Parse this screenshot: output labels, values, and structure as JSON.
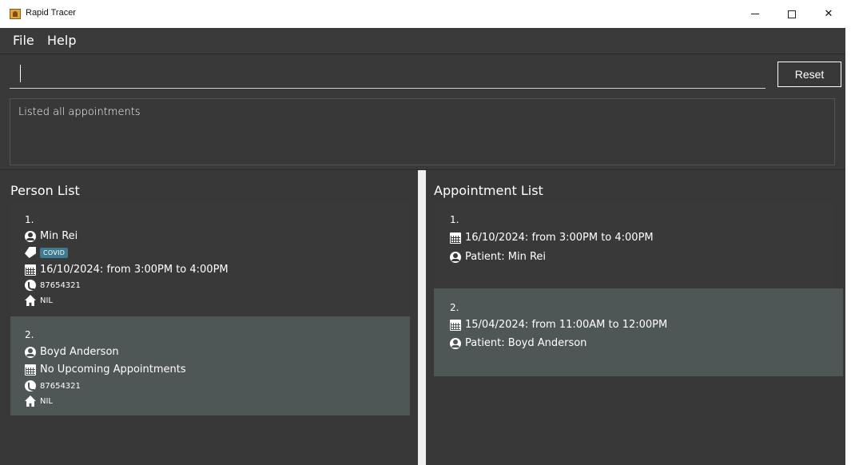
{
  "window": {
    "title": "Rapid Tracer",
    "minimize": "–",
    "close": "✕"
  },
  "menu": {
    "file": "File",
    "help": "Help"
  },
  "command": {
    "value": "",
    "reset_label": "Reset"
  },
  "result": {
    "message": "Listed all appointments"
  },
  "person_list": {
    "title": "Person List",
    "items": [
      {
        "index": "1.",
        "name": "Min Rei",
        "tag": "COVID",
        "appointment": "16/10/2024: from 3:00PM to 4:00PM",
        "phone": "87654321",
        "address": "NIL"
      },
      {
        "index": "2.",
        "name": "Boyd Anderson",
        "appointment": "No Upcoming Appointments",
        "phone": "87654321",
        "address": "NIL"
      }
    ]
  },
  "appointment_list": {
    "title": "Appointment List",
    "items": [
      {
        "index": "1.",
        "time": "16/10/2024: from 3:00PM to 4:00PM",
        "patient": "Patient: Min Rei"
      },
      {
        "index": "2.",
        "time": "15/04/2024: from 11:00AM to 12:00PM",
        "patient": "Patient: Boyd Anderson"
      }
    ]
  }
}
